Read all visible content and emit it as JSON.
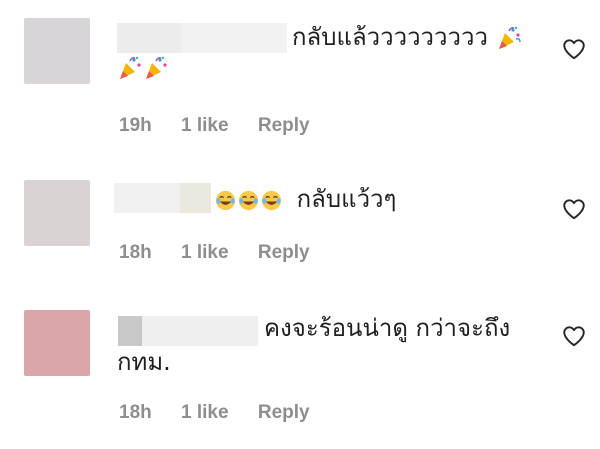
{
  "comments": [
    {
      "text_line1": "กลับแล้ววววววววว",
      "text_line2": "",
      "time": "19h",
      "likes": "1 like",
      "reply": "Reply"
    },
    {
      "text_line1": "กลับแว้วๆ",
      "text_line2": "",
      "time": "18h",
      "likes": "1 like",
      "reply": "Reply"
    },
    {
      "text_line1": "คงจะร้อนน่าดู กว่าจะถึง",
      "text_line2": "กทม.",
      "time": "18h",
      "likes": "1 like",
      "reply": "Reply"
    }
  ],
  "icons": {
    "like": "heart-outline-icon",
    "party": "party-popper-emoji",
    "laugh": "tears-of-joy-emoji"
  },
  "colors": {
    "meta_text": "#8e8e8e",
    "body_text": "#1f1f1f"
  }
}
